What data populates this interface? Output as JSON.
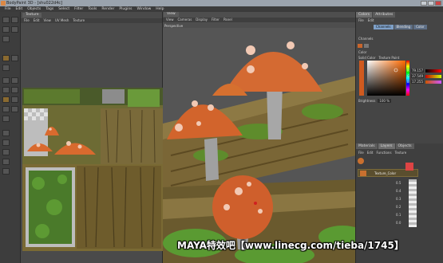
{
  "window": {
    "title": "BodyPaint 3D - [shu022d4c]"
  },
  "menubar": {
    "items": [
      "File",
      "Edit",
      "Objects",
      "Tags",
      "Select",
      "Filter",
      "Tools",
      "Render",
      "Plugins",
      "Window",
      "Help"
    ]
  },
  "texture_panel": {
    "tab": "Texture",
    "menu": [
      "File",
      "Edit",
      "View",
      "UV Mesh",
      "Texture"
    ]
  },
  "viewport": {
    "tab": "View",
    "menu": [
      "View",
      "Cameras",
      "Display",
      "Filter",
      "Panel"
    ],
    "label": "Perspective"
  },
  "right_panel": {
    "tabs": [
      "Colors",
      "Attributes"
    ],
    "menu": [
      "File",
      "Edit"
    ],
    "color_tabs": [
      "Channels",
      "Blending",
      "Color"
    ],
    "section_channels": "Channels",
    "section_color": "Color",
    "color_mode_tabs": [
      "Solid Color",
      "Texture Paint"
    ],
    "brightness_label": "Brightness",
    "brightness_value": "100 %",
    "slider_labels": [
      "R",
      "G",
      "B"
    ],
    "slider_values": [
      "79.157",
      "37.549",
      "17.255"
    ],
    "accent_color": "#cf5a1f",
    "layers_tabs": [
      "Materials",
      "Layers",
      "Objects"
    ],
    "layers_menu": [
      "File",
      "Edit",
      "Functions",
      "Texture"
    ],
    "layer_name": "Texture_Color",
    "opacity_values": [
      "0.5",
      "0.4",
      "0.3",
      "0.2",
      "0.1",
      "0.0"
    ]
  },
  "watermark": "MAYA特效吧【www.linecg.com/tieba/1745】"
}
